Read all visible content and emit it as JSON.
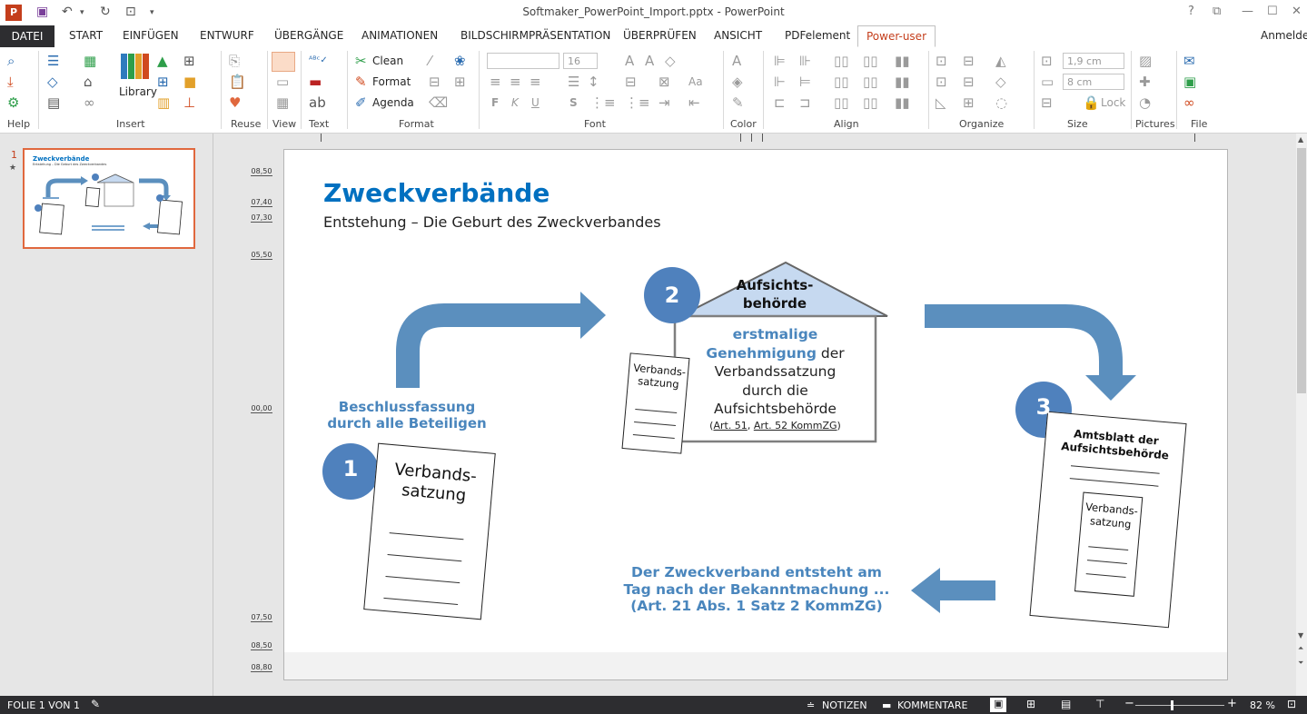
{
  "window": {
    "title": "Softmaker_PowerPoint_Import.pptx - PowerPoint",
    "help": "?",
    "ribbon_opts": "⧉",
    "minimize": "—",
    "maximize": "☐",
    "close": "✕"
  },
  "tabs": [
    {
      "label": "DATEI"
    },
    {
      "label": "START"
    },
    {
      "label": "EINFÜGEN"
    },
    {
      "label": "ENTWURF"
    },
    {
      "label": "ÜBERGÄNGE"
    },
    {
      "label": "ANIMATIONEN"
    },
    {
      "label": "BILDSCHIRMPRÄSENTATION"
    },
    {
      "label": "ÜBERPRÜFEN"
    },
    {
      "label": "ANSICHT"
    },
    {
      "label": "PDFelement"
    },
    {
      "label": "Power-user"
    }
  ],
  "account": "Anmelden",
  "ribbon": {
    "groups": [
      "Help",
      "Insert",
      "Reuse",
      "View",
      "Text",
      "Format",
      "Font",
      "Color",
      "Align",
      "Organize",
      "Size",
      "Pictures",
      "File"
    ],
    "library": "Library",
    "clean": "Clean",
    "format": "Format",
    "agenda": "Agenda",
    "font_size": "16",
    "size_w": "1,9 cm",
    "size_h": "8 cm",
    "lock": "Lock"
  },
  "thumbnail": {
    "number": "1",
    "star": "★",
    "title": "Zweckverbände",
    "subtitle": "Entstehung – Die Geburt des Zweckverbandes"
  },
  "ruler": [
    "08,50",
    "07,40",
    "07,30",
    "05,50",
    "00,00",
    "07,50",
    "08,50",
    "08,80"
  ],
  "slide": {
    "title": "Zweckverbände",
    "subtitle": "Entstehung – Die Geburt des Zweckverbandes",
    "step1": {
      "num": "1",
      "caption_l1": "Beschlussfassung",
      "caption_l2": "durch alle Beteiligen",
      "doc_l1": "Verbands-",
      "doc_l2": "satzung"
    },
    "step2": {
      "num": "2",
      "roof_l1": "Aufsichts-",
      "roof_l2": "behörde",
      "text_blue1": "erstmalige",
      "text_blue2": "Genehmigung",
      "text_rest2": " der",
      "text_l3": "Verbandssatzung",
      "text_l4": "durch die",
      "text_l5": "Aufsichtsbehörde",
      "ref_open": "(",
      "ref1": "Art. 51",
      "ref_sep": ", ",
      "ref2": "Art. 52 KommZG",
      "ref_close": ")",
      "doc_l1": "Verbands-",
      "doc_l2": "satzung"
    },
    "step3": {
      "num": "3",
      "doc_title1": "Amtsblatt der",
      "doc_title2": "Aufsichtsbehörde",
      "inner_l1": "Verbands-",
      "inner_l2": "satzung"
    },
    "final_l1": "Der Zweckverband entsteht am",
    "final_l2": "Tag nach der Bekanntmachung ...",
    "final_l3": "(Art. 21 Abs. 1 Satz 2 KommZG)"
  },
  "status": {
    "slide_info": "FOLIE 1 VON 1",
    "notes": "NOTIZEN",
    "comments": "KOMMENTARE",
    "zoom": "82 %",
    "zoom_level": 0.82
  },
  "colors": {
    "accent_blue": "#0070c0",
    "arrow_blue": "#5b8fbe",
    "circle_blue": "#4f81bd",
    "caption_blue": "#4a86bd",
    "roof_fill": "#c6d9f0",
    "office_red": "#c43e1c"
  }
}
